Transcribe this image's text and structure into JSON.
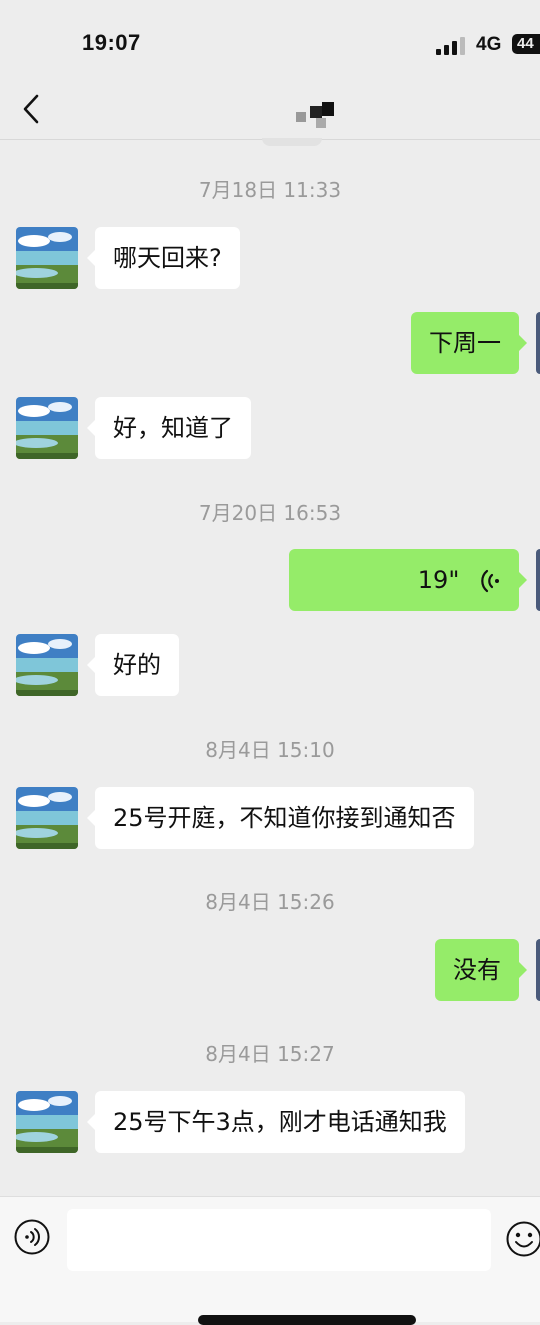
{
  "status_bar": {
    "time": "19:07",
    "network": "4G",
    "battery": "44"
  },
  "nav": {
    "back_icon": "chevron-left-icon"
  },
  "messages": [
    {
      "type": "timestamp",
      "text": "7月18日 11:33"
    },
    {
      "type": "incoming",
      "text": "哪天回来?"
    },
    {
      "type": "outgoing",
      "text": "下周一"
    },
    {
      "type": "incoming",
      "text": "好，知道了"
    },
    {
      "type": "timestamp",
      "text": "7月20日 16:53"
    },
    {
      "type": "outgoing-voice",
      "duration": "19\"",
      "icon": "voice-wave-icon"
    },
    {
      "type": "incoming",
      "text": "好的"
    },
    {
      "type": "timestamp",
      "text": "8月4日 15:10"
    },
    {
      "type": "incoming",
      "text": "25号开庭，不知道你接到通知否"
    },
    {
      "type": "timestamp",
      "text": "8月4日 15:26"
    },
    {
      "type": "outgoing",
      "text": "没有"
    },
    {
      "type": "timestamp",
      "text": "8月4日 15:27"
    },
    {
      "type": "incoming",
      "text": "25号下午3点，刚才电话通知我"
    }
  ],
  "input_bar": {
    "value": "",
    "voice_icon": "voice-input-icon",
    "emoji_icon": "emoji-icon"
  },
  "colors": {
    "background": "#ededed",
    "outgoing_bubble": "#95ec69",
    "incoming_bubble": "#ffffff",
    "timestamp": "#9a9a9a"
  }
}
